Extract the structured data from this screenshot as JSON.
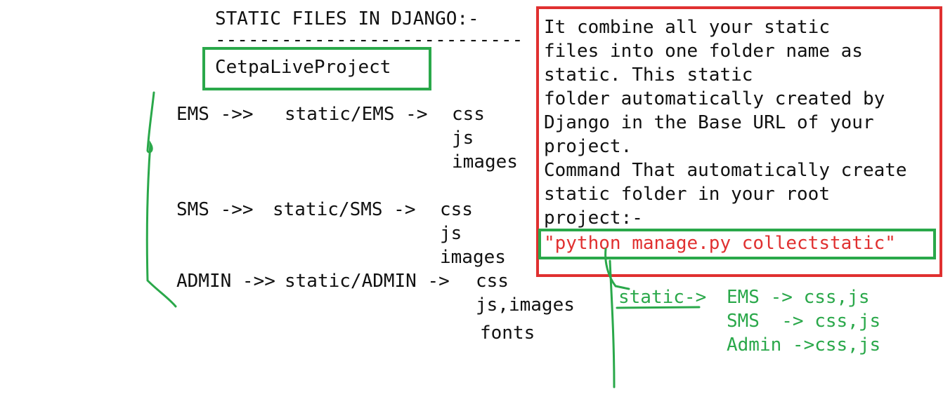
{
  "heading": "STATIC FILES IN DJANGO:-",
  "underline": "----------------------------",
  "project_name": "CetpaLiveProject",
  "apps": [
    {
      "name": "EMS ->>",
      "path": "static/EMS ->",
      "line1": "css",
      "line2": "js",
      "line3": "images"
    },
    {
      "name": "SMS ->>",
      "path": "static/SMS ->",
      "line1": "css",
      "line2": "js",
      "line3": "images"
    },
    {
      "name": "ADMIN ->>",
      "path": "static/ADMIN ->",
      "line1": "css",
      "line2": "js,images",
      "line3": "fonts"
    }
  ],
  "note": {
    "lines": [
      "It combine all your static",
      "files into one folder name as",
      "static. This static",
      "folder automatically created by",
      "Django in the Base URL of your",
      "project.",
      "Command That automatically create",
      "static folder in your root",
      "project:-"
    ],
    "command": "\"python manage.py collectstatic\""
  },
  "result": {
    "root": "static->",
    "rows": [
      "EMS -> css,js",
      "SMS  -> css,js",
      "Admin ->css,js"
    ]
  },
  "colors": {
    "green": "#2aa84a",
    "red": "#e03030",
    "text": "#111111"
  }
}
